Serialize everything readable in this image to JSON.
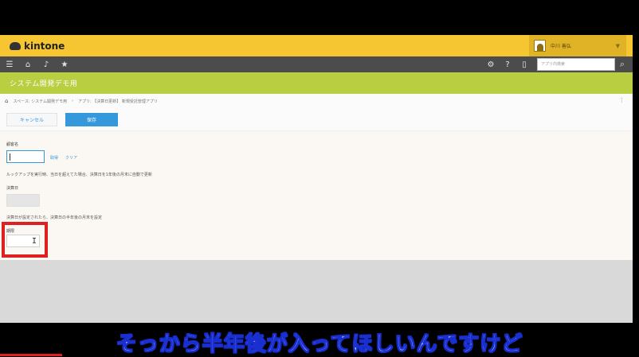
{
  "app": {
    "logo_text": "kintone",
    "user_name": "中川 善弘",
    "search_placeholder": "アプリ内検索"
  },
  "nav": {
    "icons": [
      "menu-icon",
      "home-icon",
      "bell-icon",
      "star-icon"
    ],
    "right_icons": [
      "gear-icon",
      "help-icon",
      "mobile-icon"
    ]
  },
  "space": {
    "title": "システム開発デモ用"
  },
  "breadcrumb": {
    "items": [
      "スペース: システム開発デモ用",
      "アプリ: 【決算日更新】 新規受託管理アプリ"
    ]
  },
  "toolbar": {
    "cancel_label": "キャンセル",
    "save_label": "保存"
  },
  "form": {
    "customer_label": "顧客名",
    "lookup_get": "取得",
    "lookup_clear": "クリア",
    "lookup_note": "ルックアップを実行時、当日を超えてた場合、決算日を1年後の月末に自動で更新",
    "settlement_label": "決算日",
    "settlement_note": "決算日が設定されたら、決算日の半年後の月末を設定",
    "term_label": "期限"
  },
  "caption": {
    "text": "そっから半年後が入ってほしいんですけど"
  },
  "colors": {
    "topbar": "#f5c632",
    "navbar": "#4c4c4c",
    "space_header": "#b9ce41",
    "accent": "#3498db",
    "highlight": "#e02020"
  }
}
